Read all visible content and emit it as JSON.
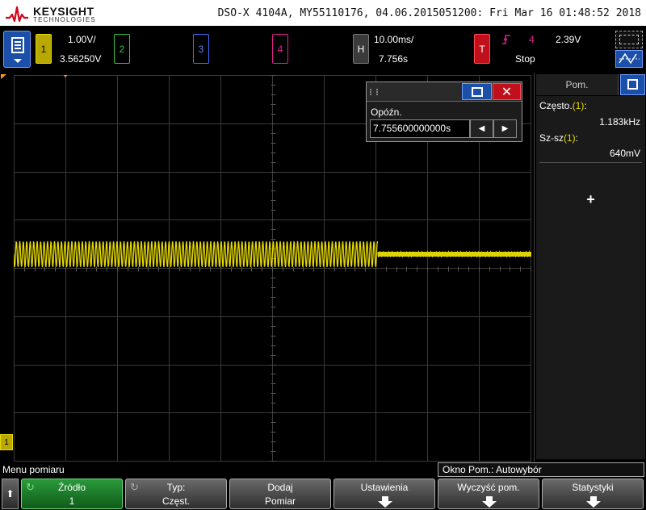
{
  "brand": {
    "name": "KEYSIGHT",
    "sub": "TECHNOLOGIES"
  },
  "device_info": "DSO-X 4104A, MY55110176, 04.06.2015051200: Fri Mar 16 01:48:52 2018",
  "channels": {
    "ch1": {
      "label": "1",
      "scale": "1.00V/",
      "offset": "3.56250V",
      "color": "#e6d900"
    },
    "ch2": {
      "label": "2",
      "color": "#35c13f"
    },
    "ch3": {
      "label": "3",
      "color": "#3c6cff"
    },
    "ch4": {
      "label": "4",
      "color": "#e0208c"
    }
  },
  "horizontal": {
    "label": "H",
    "scale": "10.00ms/",
    "delay": "7.756s"
  },
  "trigger": {
    "label": "T",
    "edge_icon": "rising-edge-icon",
    "source": "4",
    "level": "2.39V",
    "status": "Stop"
  },
  "ground_marker": "1",
  "delay_popup": {
    "label": "Opóźn.",
    "value": "7.755600000000s",
    "close": "✕",
    "left": "◀",
    "right": "▶"
  },
  "measurements": {
    "tab_label": "Pom.",
    "items": [
      {
        "name": "Często.",
        "channel": "(1)",
        "colon": ":",
        "value": "1.183kHz"
      },
      {
        "name": "Sz-sz",
        "channel": "(1)",
        "colon": ":",
        "value": "640mV"
      }
    ],
    "add": "+"
  },
  "softkeys": {
    "menu_name": "Menu pomiaru",
    "mode": "Okno Pom.: Autowybór",
    "back": "⬆",
    "keys": [
      {
        "l1": "Źródło",
        "l2": "1"
      },
      {
        "l1": "Typ:",
        "l2": "Częst."
      },
      {
        "l1": "Dodaj",
        "l2": "Pomiar"
      },
      {
        "l1": "Ustawienia",
        "l2": ""
      },
      {
        "l1": "Wyczyść pom.",
        "l2": ""
      },
      {
        "l1": "Statystyki",
        "l2": ""
      }
    ]
  },
  "waveform": {
    "color": "#e6d900",
    "grid_color": "#3a3a3a",
    "grid_divisions": {
      "x": 10,
      "y": 8
    },
    "burst_end_fraction": 0.703,
    "signal_frequency": "1.183kHz",
    "signal_amplitude": "640mV"
  }
}
